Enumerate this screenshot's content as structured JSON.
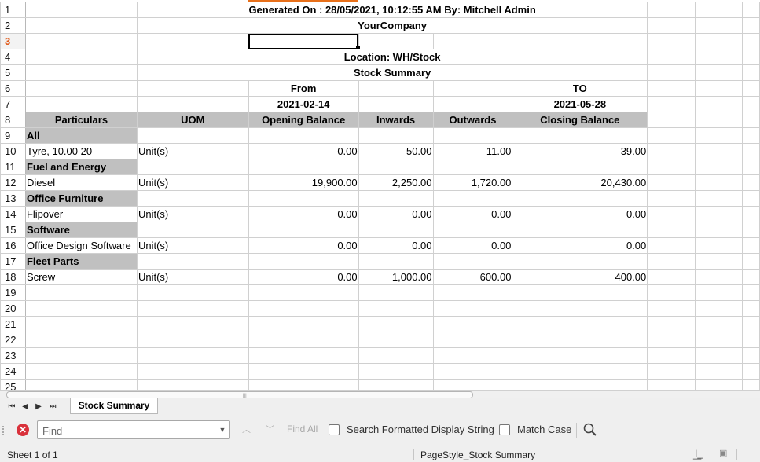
{
  "sheet": {
    "rows": [
      {
        "num": "1",
        "title": "Generated On : 28/05/2021, 10:12:55 AM   By:  Mitchell Admin"
      },
      {
        "num": "2",
        "title": "YourCompany"
      },
      {
        "num": "3"
      },
      {
        "num": "4",
        "title": "Location: WH/Stock"
      },
      {
        "num": "5",
        "title": "Stock Summary"
      },
      {
        "num": "6",
        "from": "From",
        "to": "TO"
      },
      {
        "num": "7",
        "from": "2021-02-14",
        "to": "2021-05-28"
      },
      {
        "num": "8",
        "headers": [
          "Particulars",
          "UOM",
          "Opening Balance",
          "Inwards",
          "Outwards",
          "Closing Balance"
        ]
      },
      {
        "num": "9",
        "category": "All"
      },
      {
        "num": "10",
        "item": [
          "Tyre, 10.00 20",
          "Unit(s)",
          "0.00",
          "50.00",
          "11.00",
          "39.00"
        ]
      },
      {
        "num": "11",
        "category": "Fuel and Energy"
      },
      {
        "num": "12",
        "item": [
          "Diesel",
          "Unit(s)",
          "19,900.00",
          "2,250.00",
          "1,720.00",
          "20,430.00"
        ]
      },
      {
        "num": "13",
        "category": "Office Furniture"
      },
      {
        "num": "14",
        "item": [
          "Flipover",
          "Unit(s)",
          "0.00",
          "0.00",
          "0.00",
          "0.00"
        ]
      },
      {
        "num": "15",
        "category": "Software"
      },
      {
        "num": "16",
        "item": [
          "Office Design Software",
          "Unit(s)",
          "0.00",
          "0.00",
          "0.00",
          "0.00"
        ]
      },
      {
        "num": "17",
        "category": "Fleet Parts"
      },
      {
        "num": "18",
        "item": [
          "Screw",
          "Unit(s)",
          "0.00",
          "1,000.00",
          "600.00",
          "400.00"
        ]
      },
      {
        "num": "19"
      },
      {
        "num": "20"
      },
      {
        "num": "21"
      },
      {
        "num": "22"
      },
      {
        "num": "23"
      },
      {
        "num": "24"
      },
      {
        "num": "25"
      }
    ],
    "active_row": "3"
  },
  "tabs": {
    "nav": [
      "⏮",
      "◀",
      "▶",
      "⏭"
    ],
    "sheet_tab": "Stock Summary"
  },
  "findbar": {
    "close_icon": "close-icon",
    "placeholder": "Find",
    "find_all": "Find All",
    "search_formatted": "Search Formatted Display String",
    "match_case": "Match Case"
  },
  "status": {
    "sheet_info": "Sheet 1 of 1",
    "page_style": "PageStyle_Stock Summary"
  },
  "colors": {
    "header_fill": "#c0c0c0",
    "active_row_color": "#e05a1a",
    "close_button": "#d9313b"
  }
}
